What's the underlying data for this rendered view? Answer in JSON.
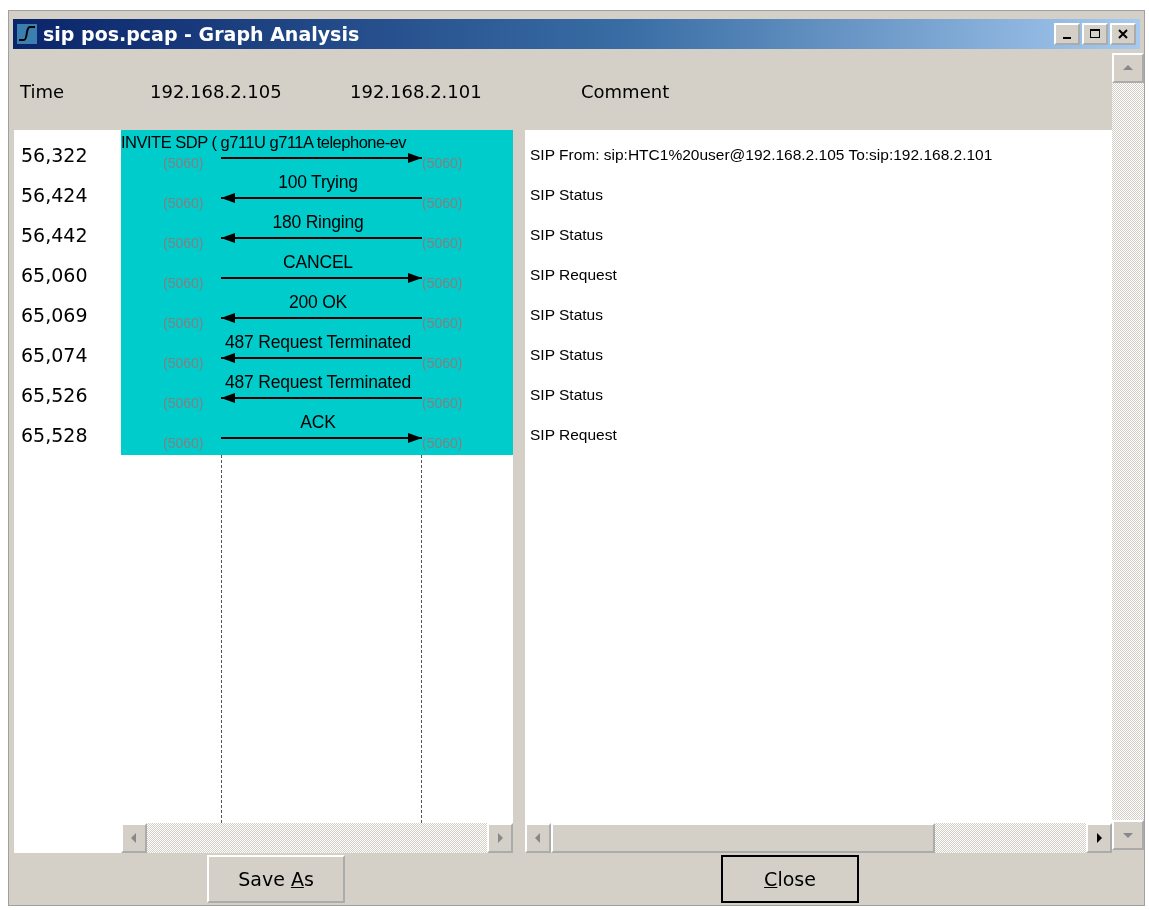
{
  "window": {
    "title": "sip pos.pcap - Graph Analysis"
  },
  "header": {
    "time": "Time",
    "hosts": [
      "192.168.2.105",
      "192.168.2.101"
    ],
    "comment": "Comment"
  },
  "messages": [
    {
      "time": "56,322",
      "label": "INVITE SDP ( g711U g711A telephone-ev",
      "kind": "rightward",
      "left_port": "(5060)",
      "right_port": "(5060)",
      "comment": "SIP From: sip:HTC1%20user@192.168.2.105 To:sip:192.168.2.101"
    },
    {
      "time": "56,424",
      "label": "100 Trying",
      "kind": "leftward",
      "left_port": "(5060)",
      "right_port": "(5060)",
      "comment": "SIP Status"
    },
    {
      "time": "56,442",
      "label": "180 Ringing",
      "kind": "leftward",
      "left_port": "(5060)",
      "right_port": "(5060)",
      "comment": "SIP Status"
    },
    {
      "time": "65,060",
      "label": "CANCEL",
      "kind": "rightward",
      "left_port": "(5060)",
      "right_port": "(5060)",
      "comment": "SIP Request"
    },
    {
      "time": "65,069",
      "label": "200 OK",
      "kind": "leftward",
      "left_port": "(5060)",
      "right_port": "(5060)",
      "comment": "SIP Status"
    },
    {
      "time": "65,074",
      "label": "487 Request Terminated",
      "kind": "leftward",
      "left_port": "(5060)",
      "right_port": "(5060)",
      "comment": "SIP Status"
    },
    {
      "time": "65,526",
      "label": "487 Request Terminated",
      "kind": "leftward",
      "left_port": "(5060)",
      "right_port": "(5060)",
      "comment": "SIP Status"
    },
    {
      "time": "65,528",
      "label": "ACK",
      "kind": "rightward",
      "left_port": "(5060)",
      "right_port": "(5060)",
      "comment": "SIP Request"
    }
  ],
  "buttons": [
    {
      "before": "Save ",
      "mnemonic": "A",
      "after": "s"
    },
    {
      "mnemonic": "C",
      "after": "lose"
    }
  ]
}
